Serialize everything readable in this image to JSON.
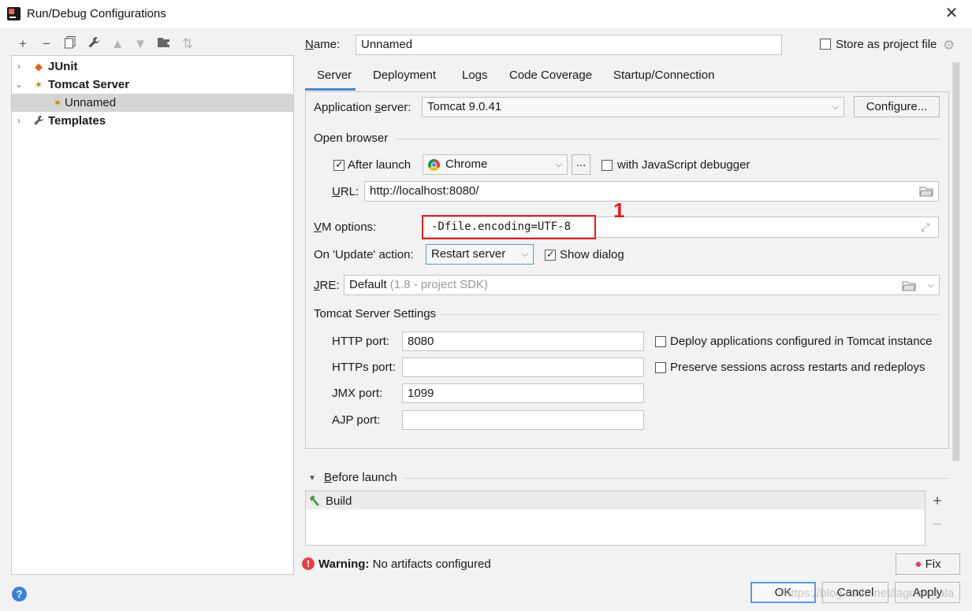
{
  "window": {
    "title": "Run/Debug Configurations"
  },
  "tree": {
    "items": [
      {
        "label": "JUnit",
        "bold": true
      },
      {
        "label": "Tomcat Server",
        "bold": true
      },
      {
        "label": "Unnamed",
        "bold": false,
        "selected": true
      },
      {
        "label": "Templates",
        "bold": true
      }
    ]
  },
  "form": {
    "name_label": "Name:",
    "name_value": "Unnamed",
    "store_label": "Store as project file",
    "store_checked": false
  },
  "tabs": [
    "Server",
    "Deployment",
    "Logs",
    "Code Coverage",
    "Startup/Connection"
  ],
  "server": {
    "app_server_label": "Application server:",
    "app_server_value": "Tomcat 9.0.41",
    "configure_label": "Configure...",
    "open_browser_label": "Open browser",
    "after_launch_label": "After launch",
    "after_launch_checked": true,
    "browser_value": "Chrome",
    "browse_ellipsis": "...",
    "js_debugger_label": "with JavaScript debugger",
    "url_label": "URL:",
    "url_value": "http://localhost:8080/",
    "vm_options_label": "VM options:",
    "vm_options_value": "-Dfile.encoding=UTF-8",
    "on_update_label": "On 'Update' action:",
    "on_update_value": "Restart server",
    "show_dialog_label": "Show dialog",
    "show_dialog_checked": true,
    "jre_label": "JRE:",
    "jre_value": "Default",
    "jre_hint": "(1.8 - project SDK)",
    "tomcat_settings_label": "Tomcat Server Settings",
    "http_port_label": "HTTP port:",
    "http_port_value": "8080",
    "https_port_label": "HTTPs port:",
    "https_port_value": "",
    "jmx_port_label": "JMX port:",
    "jmx_port_value": "1099",
    "ajp_port_label": "AJP port:",
    "ajp_port_value": "",
    "deploy_label": "Deploy applications configured in Tomcat instance",
    "preserve_label": "Preserve sessions across restarts and redeploys"
  },
  "annotation": {
    "number": "1",
    "color": "#e02020"
  },
  "before_launch": {
    "title": "Before launch",
    "items": [
      "Build"
    ]
  },
  "warning": {
    "bold": "Warning:",
    "text": "No artifacts configured",
    "fix_label": "Fix"
  },
  "buttons": {
    "ok": "OK",
    "cancel": "Cancel",
    "apply": "Apply"
  },
  "watermark": "https://blog.csdn.net/lagoon_lala",
  "colors": {
    "accent": "#4a88c7",
    "selected_row": "#d5d5d5",
    "annotation": "#e02020"
  }
}
